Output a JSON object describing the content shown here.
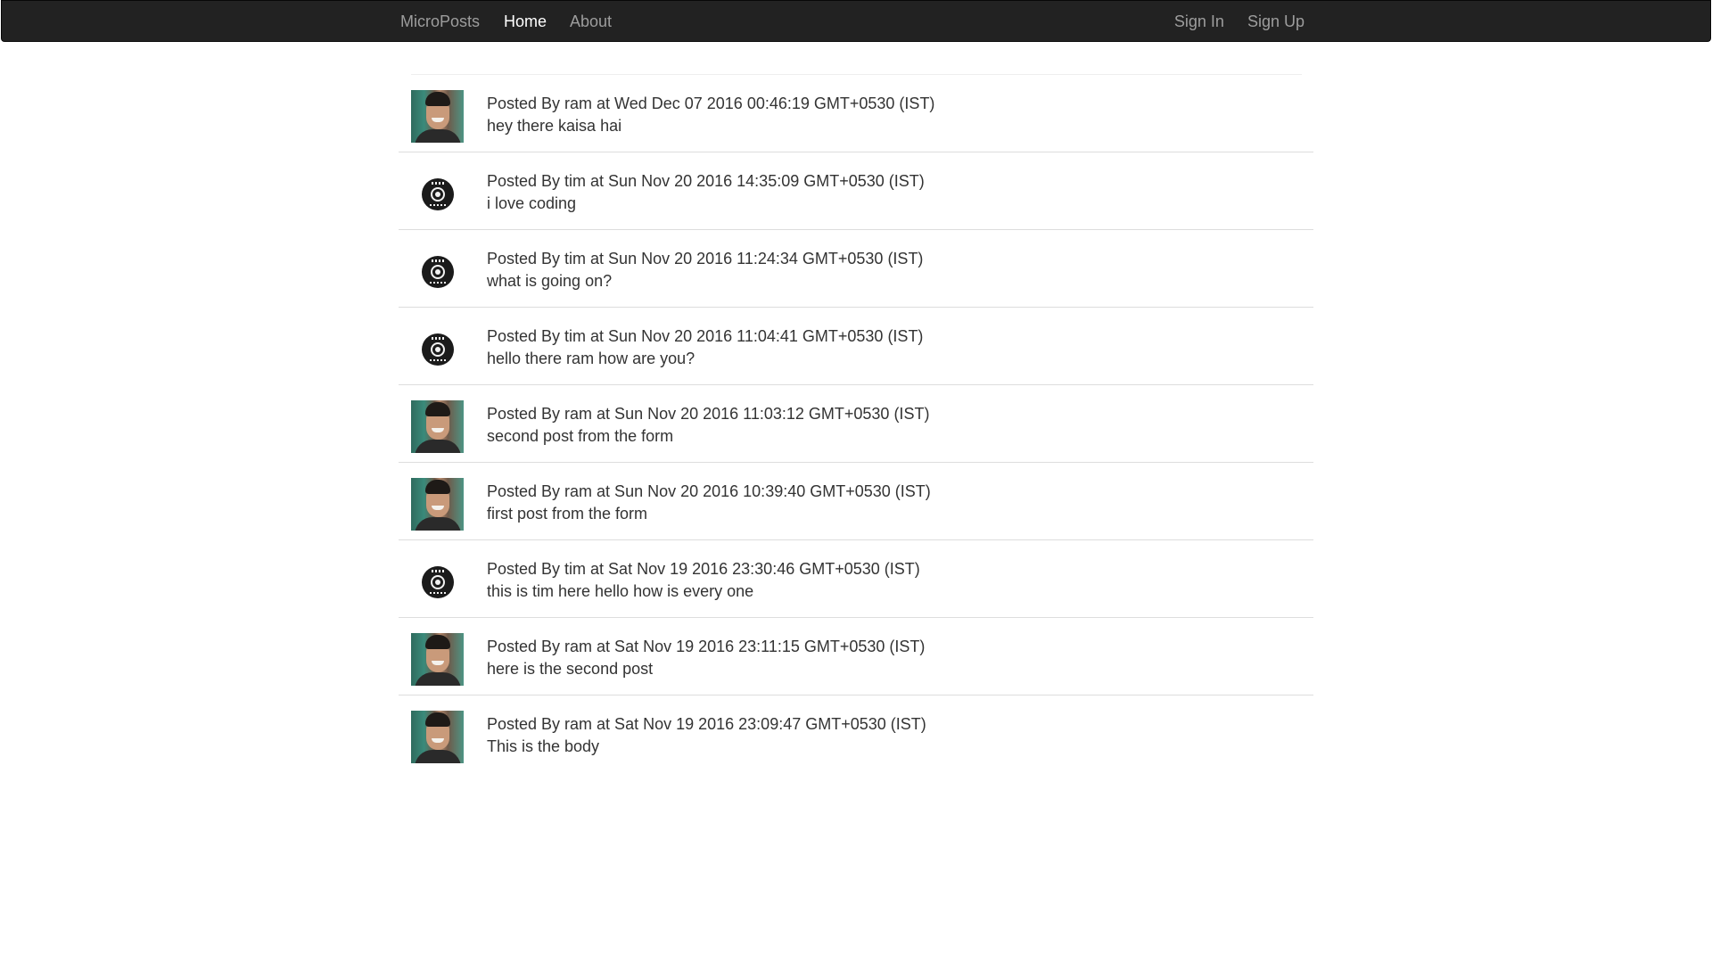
{
  "navbar": {
    "brand": "MicroPosts",
    "left_links": [
      {
        "label": "Home",
        "active": true
      },
      {
        "label": "About",
        "active": false
      }
    ],
    "right_links": [
      {
        "label": "Sign In"
      },
      {
        "label": "Sign Up"
      }
    ]
  },
  "posts": [
    {
      "meta": "Posted By ram at Wed Dec 07 2016 00:46:19 GMT+0530 (IST)",
      "body": "hey there kaisa hai",
      "avatar": "ram-photo-avatar"
    },
    {
      "meta": "Posted By tim at Sun Nov 20 2016 14:35:09 GMT+0530 (IST)",
      "body": "i love coding",
      "avatar": "tim-disc-avatar"
    },
    {
      "meta": "Posted By tim at Sun Nov 20 2016 11:24:34 GMT+0530 (IST)",
      "body": "what is going on?",
      "avatar": "tim-disc-avatar"
    },
    {
      "meta": "Posted By tim at Sun Nov 20 2016 11:04:41 GMT+0530 (IST)",
      "body": "hello there ram how are you?",
      "avatar": "tim-disc-avatar"
    },
    {
      "meta": "Posted By ram at Sun Nov 20 2016 11:03:12 GMT+0530 (IST)",
      "body": "second post from the form",
      "avatar": "ram-photo-avatar"
    },
    {
      "meta": "Posted By ram at Sun Nov 20 2016 10:39:40 GMT+0530 (IST)",
      "body": "first post from the form",
      "avatar": "ram-photo-avatar"
    },
    {
      "meta": "Posted By tim at Sat Nov 19 2016 23:30:46 GMT+0530 (IST)",
      "body": "this is tim here hello how is every one",
      "avatar": "tim-disc-avatar"
    },
    {
      "meta": "Posted By ram at Sat Nov 19 2016 23:11:15 GMT+0530 (IST)",
      "body": "here is the second post",
      "avatar": "ram-photo-avatar"
    },
    {
      "meta": "Posted By ram at Sat Nov 19 2016 23:09:47 GMT+0530 (IST)",
      "body": "This is the body",
      "avatar": "ram-photo-avatar"
    }
  ],
  "colors": {
    "navbar_bg": "#222222",
    "nav_link": "#9d9d9d",
    "nav_active": "#ffffff",
    "text": "#333333",
    "divider": "#dddddd"
  }
}
